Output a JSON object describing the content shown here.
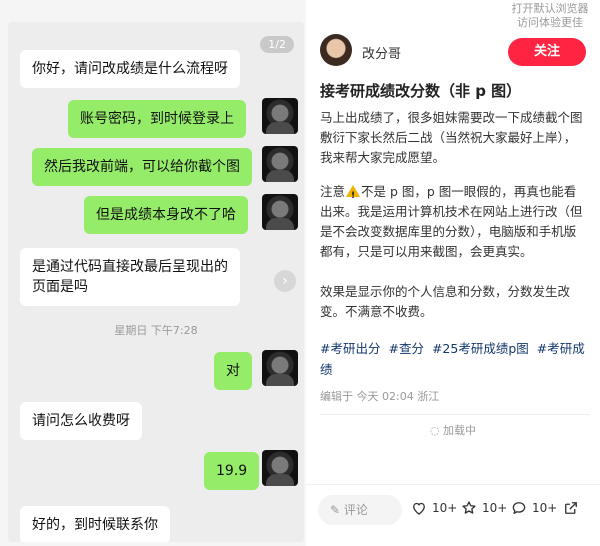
{
  "chat": {
    "pager": "1/2",
    "timestamp": "星期日 下午7:28",
    "messages": [
      {
        "side": "in",
        "text": "你好，请问改成绩是什么流程呀"
      },
      {
        "side": "out",
        "text": "账号密码，到时候登录上"
      },
      {
        "side": "out",
        "text": "然后我改前端，可以给你截个图"
      },
      {
        "side": "out",
        "text": "但是成绩本身改不了哈"
      },
      {
        "side": "in",
        "text": "是通过代码直接改最后呈现出的\n页面是吗"
      },
      {
        "side": "out",
        "text": "对"
      },
      {
        "side": "in",
        "text": "请问怎么收费呀"
      },
      {
        "side": "out",
        "text": "19.9"
      },
      {
        "side": "in",
        "text": "好的，到时候联系你"
      }
    ]
  },
  "browser_hint": {
    "line1": "打开默认浏览器",
    "line2": "访问体验更佳"
  },
  "post": {
    "author": "改分哥",
    "follow_label": "关注",
    "title": "接考研成绩改分数（非 p 图）",
    "para1": "马上出成绩了，很多姐妹需要改一下成绩截个图敷衍下家长然后二战（当然祝大家最好上岸），我来帮大家完成愿望。",
    "para2_a": "注意",
    "para2_b": "不是 p 图，p 图一眼假的，再真也能看出来。我是运用计算机技术在网站上进行改（但是不会改变数据库里的分数），电脑版和手机版都有，只是可以用来截图，会更真实。",
    "para3": "效果是显示你的个人信息和分数，分数发生改变。不满意不收费。",
    "tags": [
      "#考研出分",
      "#查分",
      "#25考研成绩p图",
      "#考研成绩"
    ],
    "meta": "编辑于 今天 02:04 浙江",
    "loading": "加载中",
    "comment_placeholder": "评论",
    "likes": "10+",
    "collects": "10+",
    "comments": "10+"
  },
  "colors": {
    "accent": "#ff2442",
    "bubble_out": "#95ec69",
    "tag": "#13386c"
  },
  "icons": [
    "heart-icon",
    "star-icon",
    "comment-icon",
    "share-icon",
    "warning-icon",
    "edit-icon",
    "chevron-right-icon",
    "loading-icon"
  ]
}
